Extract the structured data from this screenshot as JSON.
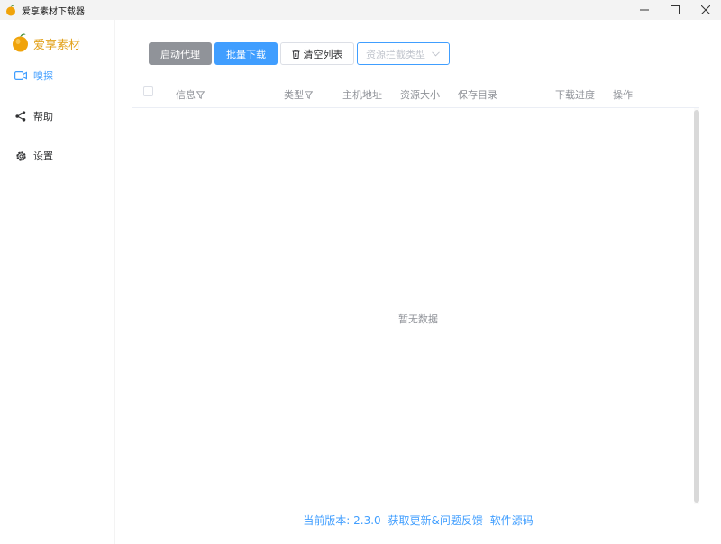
{
  "window": {
    "title": "爱享素材下载器",
    "controls": [
      "minimize",
      "maximize",
      "close"
    ]
  },
  "sidebar": {
    "brand": "爱享素材",
    "items": [
      {
        "label": "嗅探",
        "icon": "video-camera-icon",
        "active": true
      },
      {
        "label": "帮助",
        "icon": "share-icon",
        "active": false
      },
      {
        "label": "设置",
        "icon": "gear-icon",
        "active": false
      }
    ]
  },
  "toolbar": {
    "start_proxy": "启动代理",
    "batch_download": "批量下载",
    "clear_list": "清空列表",
    "resource_type_placeholder": "资源拦截类型"
  },
  "table": {
    "columns": [
      "信息",
      "类型",
      "主机地址",
      "资源大小",
      "保存目录",
      "下载进度",
      "操作"
    ],
    "rows": [],
    "empty_text": "暂无数据"
  },
  "footer": {
    "version": "当前版本: 2.3.0",
    "updates_feedback": "获取更新&问题反馈",
    "source_code": "软件源码"
  },
  "colors": {
    "accent": "#409eff",
    "brand": "#e2a11a",
    "gray_button": "#909399"
  }
}
